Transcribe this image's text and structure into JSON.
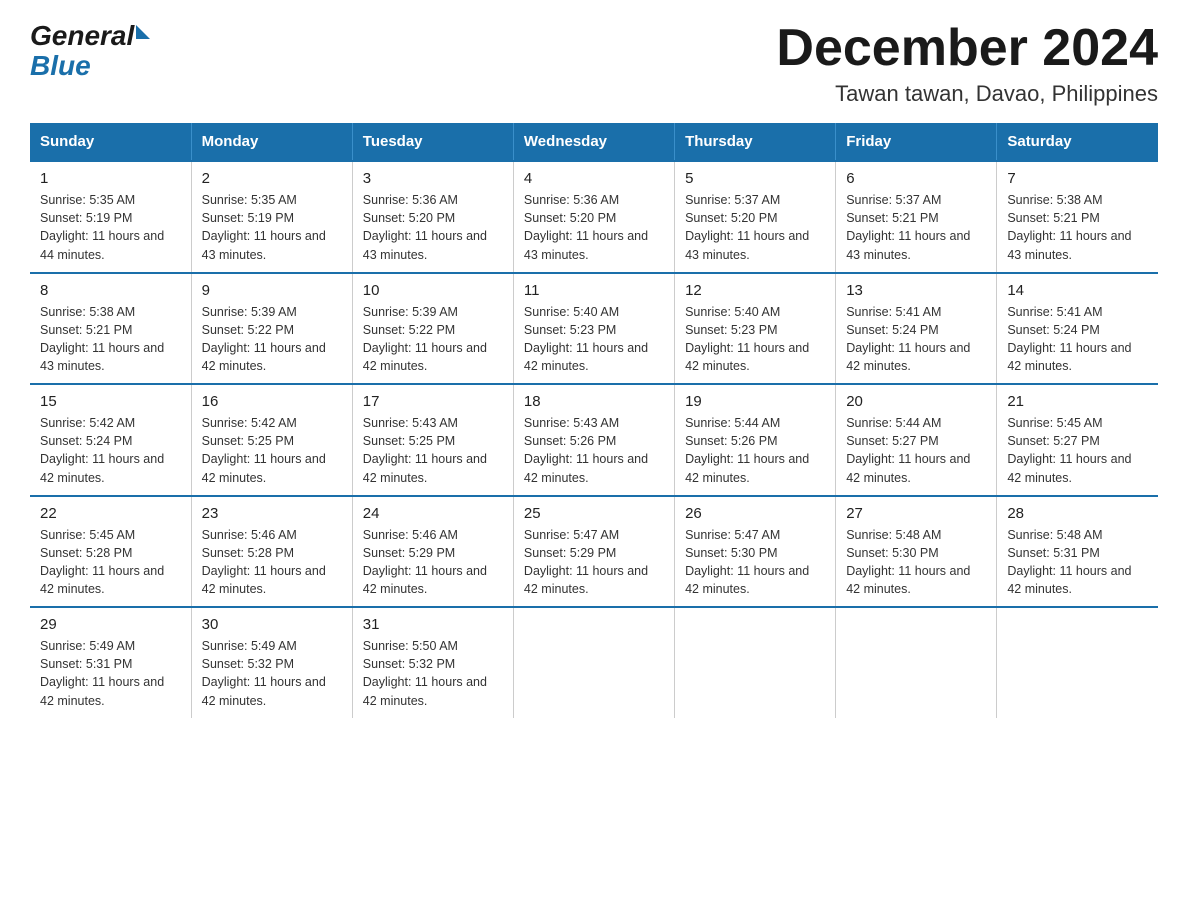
{
  "logo": {
    "general": "General",
    "blue": "Blue"
  },
  "title": "December 2024",
  "subtitle": "Tawan tawan, Davao, Philippines",
  "days_of_week": [
    "Sunday",
    "Monday",
    "Tuesday",
    "Wednesday",
    "Thursday",
    "Friday",
    "Saturday"
  ],
  "weeks": [
    [
      {
        "day": "1",
        "sunrise": "5:35 AM",
        "sunset": "5:19 PM",
        "daylight": "11 hours and 44 minutes."
      },
      {
        "day": "2",
        "sunrise": "5:35 AM",
        "sunset": "5:19 PM",
        "daylight": "11 hours and 43 minutes."
      },
      {
        "day": "3",
        "sunrise": "5:36 AM",
        "sunset": "5:20 PM",
        "daylight": "11 hours and 43 minutes."
      },
      {
        "day": "4",
        "sunrise": "5:36 AM",
        "sunset": "5:20 PM",
        "daylight": "11 hours and 43 minutes."
      },
      {
        "day": "5",
        "sunrise": "5:37 AM",
        "sunset": "5:20 PM",
        "daylight": "11 hours and 43 minutes."
      },
      {
        "day": "6",
        "sunrise": "5:37 AM",
        "sunset": "5:21 PM",
        "daylight": "11 hours and 43 minutes."
      },
      {
        "day": "7",
        "sunrise": "5:38 AM",
        "sunset": "5:21 PM",
        "daylight": "11 hours and 43 minutes."
      }
    ],
    [
      {
        "day": "8",
        "sunrise": "5:38 AM",
        "sunset": "5:21 PM",
        "daylight": "11 hours and 43 minutes."
      },
      {
        "day": "9",
        "sunrise": "5:39 AM",
        "sunset": "5:22 PM",
        "daylight": "11 hours and 42 minutes."
      },
      {
        "day": "10",
        "sunrise": "5:39 AM",
        "sunset": "5:22 PM",
        "daylight": "11 hours and 42 minutes."
      },
      {
        "day": "11",
        "sunrise": "5:40 AM",
        "sunset": "5:23 PM",
        "daylight": "11 hours and 42 minutes."
      },
      {
        "day": "12",
        "sunrise": "5:40 AM",
        "sunset": "5:23 PM",
        "daylight": "11 hours and 42 minutes."
      },
      {
        "day": "13",
        "sunrise": "5:41 AM",
        "sunset": "5:24 PM",
        "daylight": "11 hours and 42 minutes."
      },
      {
        "day": "14",
        "sunrise": "5:41 AM",
        "sunset": "5:24 PM",
        "daylight": "11 hours and 42 minutes."
      }
    ],
    [
      {
        "day": "15",
        "sunrise": "5:42 AM",
        "sunset": "5:24 PM",
        "daylight": "11 hours and 42 minutes."
      },
      {
        "day": "16",
        "sunrise": "5:42 AM",
        "sunset": "5:25 PM",
        "daylight": "11 hours and 42 minutes."
      },
      {
        "day": "17",
        "sunrise": "5:43 AM",
        "sunset": "5:25 PM",
        "daylight": "11 hours and 42 minutes."
      },
      {
        "day": "18",
        "sunrise": "5:43 AM",
        "sunset": "5:26 PM",
        "daylight": "11 hours and 42 minutes."
      },
      {
        "day": "19",
        "sunrise": "5:44 AM",
        "sunset": "5:26 PM",
        "daylight": "11 hours and 42 minutes."
      },
      {
        "day": "20",
        "sunrise": "5:44 AM",
        "sunset": "5:27 PM",
        "daylight": "11 hours and 42 minutes."
      },
      {
        "day": "21",
        "sunrise": "5:45 AM",
        "sunset": "5:27 PM",
        "daylight": "11 hours and 42 minutes."
      }
    ],
    [
      {
        "day": "22",
        "sunrise": "5:45 AM",
        "sunset": "5:28 PM",
        "daylight": "11 hours and 42 minutes."
      },
      {
        "day": "23",
        "sunrise": "5:46 AM",
        "sunset": "5:28 PM",
        "daylight": "11 hours and 42 minutes."
      },
      {
        "day": "24",
        "sunrise": "5:46 AM",
        "sunset": "5:29 PM",
        "daylight": "11 hours and 42 minutes."
      },
      {
        "day": "25",
        "sunrise": "5:47 AM",
        "sunset": "5:29 PM",
        "daylight": "11 hours and 42 minutes."
      },
      {
        "day": "26",
        "sunrise": "5:47 AM",
        "sunset": "5:30 PM",
        "daylight": "11 hours and 42 minutes."
      },
      {
        "day": "27",
        "sunrise": "5:48 AM",
        "sunset": "5:30 PM",
        "daylight": "11 hours and 42 minutes."
      },
      {
        "day": "28",
        "sunrise": "5:48 AM",
        "sunset": "5:31 PM",
        "daylight": "11 hours and 42 minutes."
      }
    ],
    [
      {
        "day": "29",
        "sunrise": "5:49 AM",
        "sunset": "5:31 PM",
        "daylight": "11 hours and 42 minutes."
      },
      {
        "day": "30",
        "sunrise": "5:49 AM",
        "sunset": "5:32 PM",
        "daylight": "11 hours and 42 minutes."
      },
      {
        "day": "31",
        "sunrise": "5:50 AM",
        "sunset": "5:32 PM",
        "daylight": "11 hours and 42 minutes."
      },
      null,
      null,
      null,
      null
    ]
  ]
}
